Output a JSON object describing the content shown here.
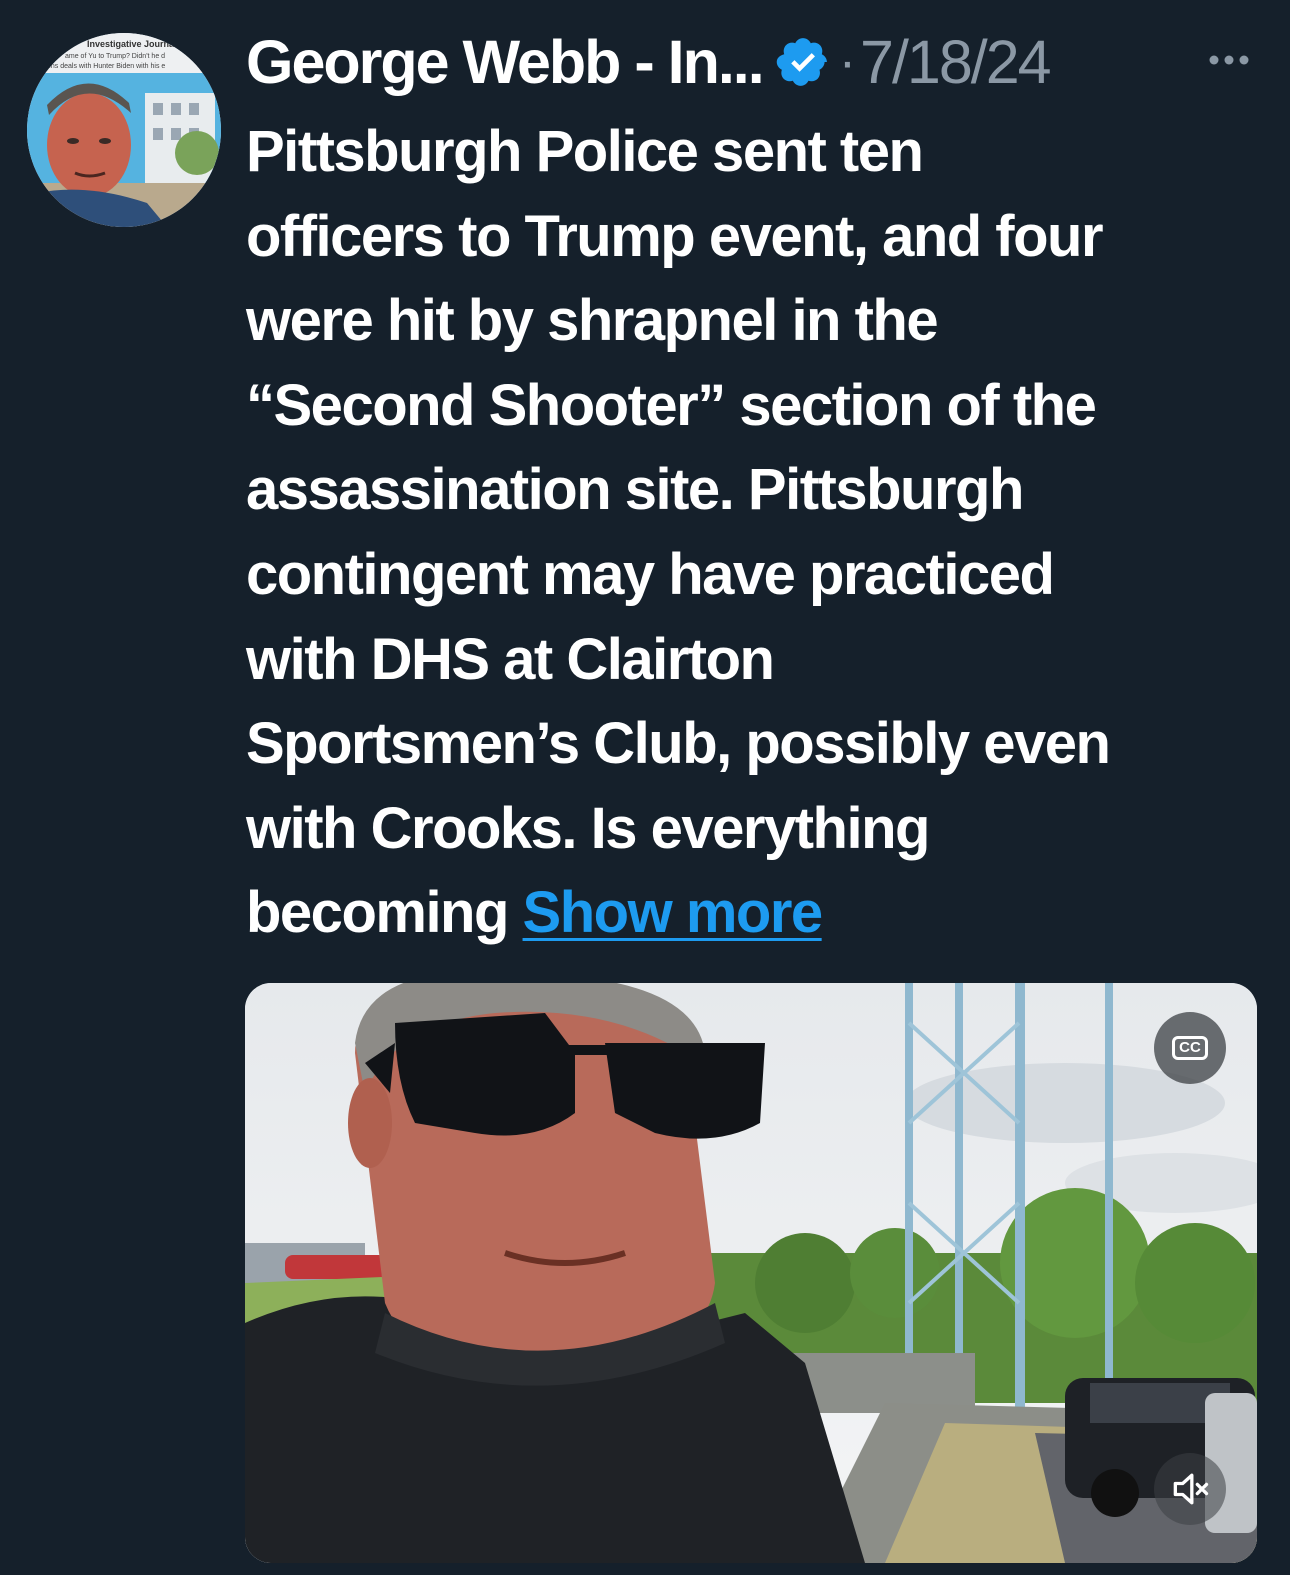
{
  "author": {
    "display_name": "George Webb - In...",
    "verified": true,
    "avatar_text_lines": [
      "Investigative Journalist",
      "ame of Yu to Trump? Didn't he d",
      "ons deals with Hunter Biden with his e"
    ]
  },
  "post": {
    "separator": "·",
    "timestamp": "7/18/24",
    "text_lines": [
      "Pittsburgh Police sent ten",
      "officers to Trump event, and four",
      "were hit by shrapnel in the",
      "“Second Shooter” section of the",
      "assassination site. Pittsburgh",
      "contingent may have practiced",
      "with DHS at Clairton",
      "Sportsmen’s Club, possibly even",
      "with Crooks.  Is everything"
    ],
    "last_line_text": "becoming",
    "show_more_label": "Show more"
  },
  "media": {
    "type": "video",
    "cc_label": "CC",
    "muted": true
  },
  "icons": {
    "verified": "verified-badge-icon",
    "more": "more-options-icon",
    "captions": "closed-captions-icon",
    "mute": "volume-muted-icon"
  },
  "colors": {
    "background": "#15202b",
    "text": "#ffffff",
    "secondary_text": "#8b98a5",
    "link": "#1d9bf0",
    "verified": "#1d9bf0"
  }
}
